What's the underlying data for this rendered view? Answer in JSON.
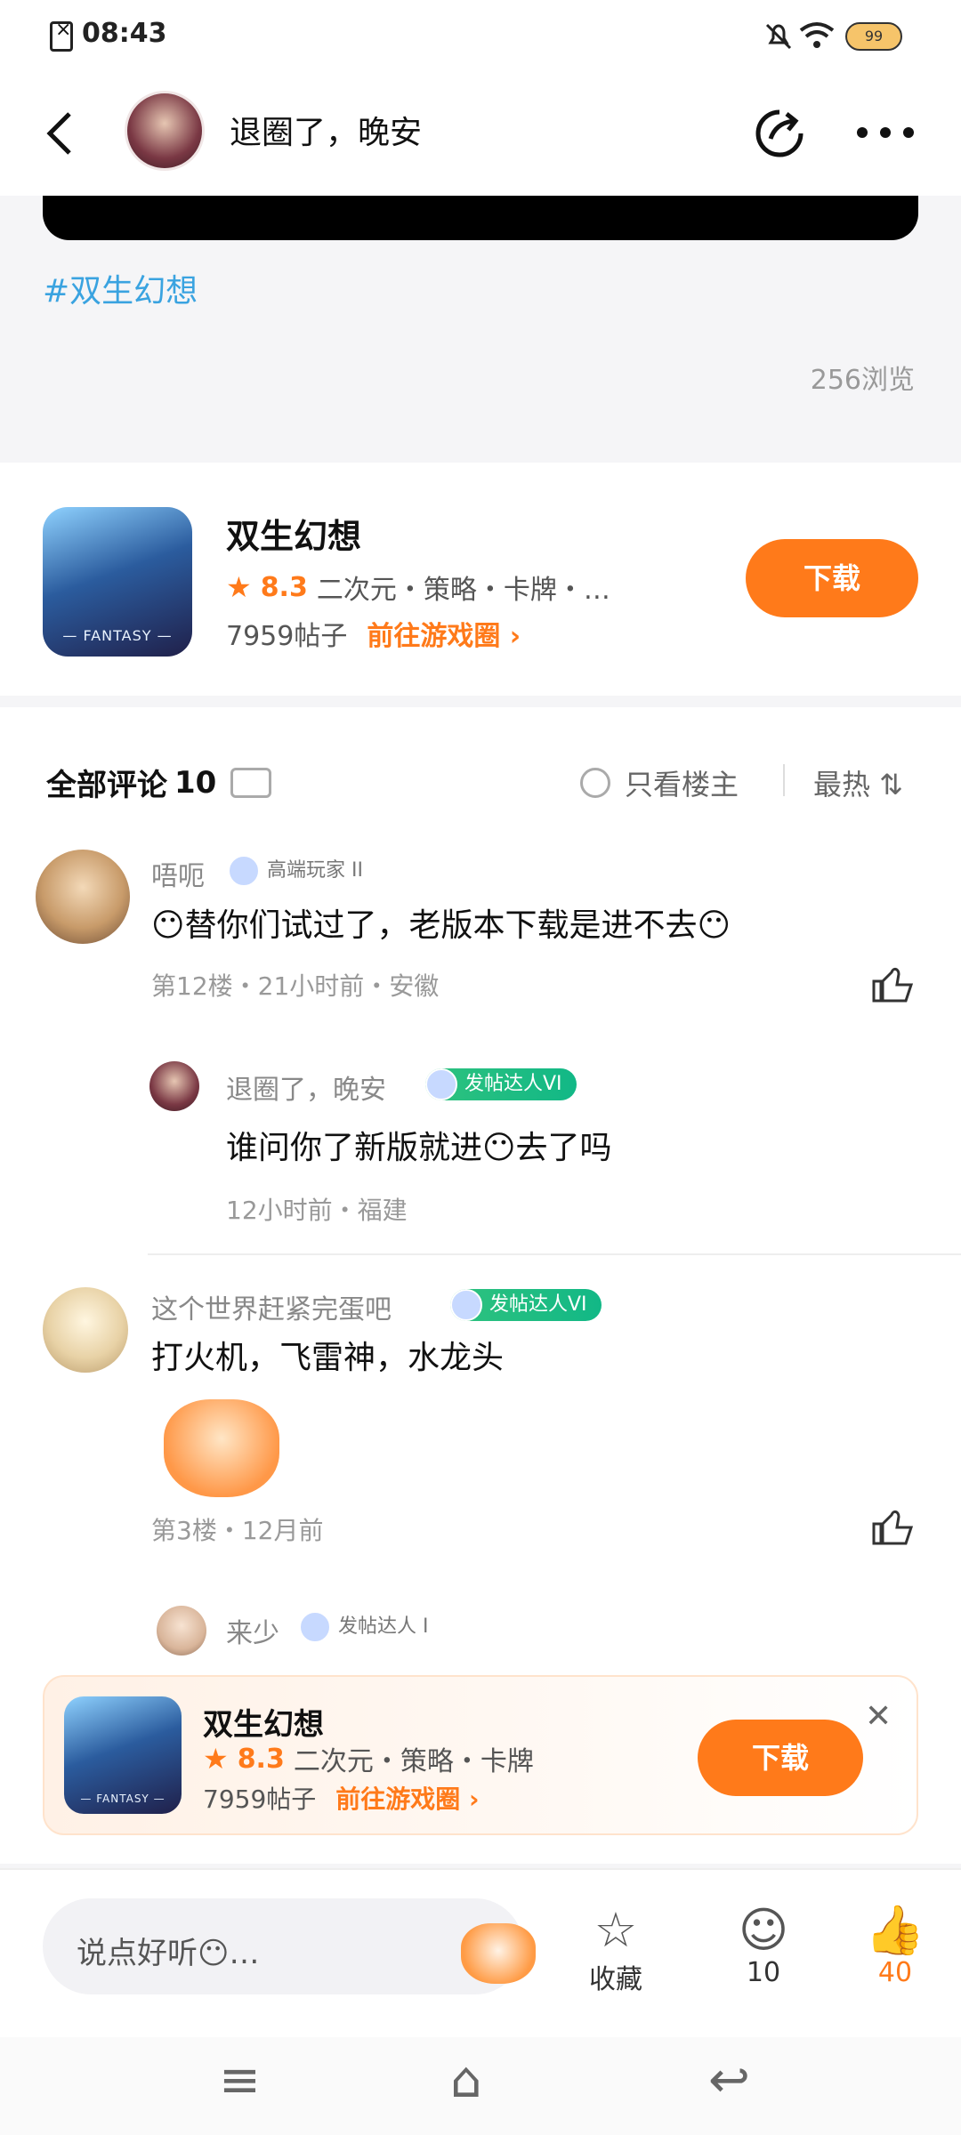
{
  "status": {
    "time": "08:43",
    "battery": "99"
  },
  "header": {
    "title": "退圈了，晚安"
  },
  "post": {
    "tag": "#双生幻想",
    "views": "256浏览"
  },
  "game": {
    "name": "双生幻想",
    "score": "8.3",
    "genres": "二次元・策略・卡牌・…",
    "posts": "7959帖子",
    "goto": "前往游戏圈 ›",
    "download": "下载"
  },
  "comments": {
    "title": "全部评论",
    "count": "10",
    "only_op": "只看楼主",
    "sort": "最热 ⇅",
    "items": [
      {
        "user": "唔呃",
        "badge": "高端玩家 II",
        "text": "😶替你们试过了，老版本下载是进不去😶",
        "meta": "第12楼・21小时前・安徽",
        "reply": {
          "user": "退圈了，晚安",
          "badge": "发帖达人VI",
          "text": "谁问你了新版就进😶去了吗",
          "meta": "12小时前・福建"
        }
      },
      {
        "user": "这个世界赶紧完蛋吧",
        "badge": "发帖达人VI",
        "text": "打火机，飞雷神，水龙头",
        "meta": "第3楼・12月前",
        "reply": {
          "user": "来少",
          "badge": "发帖达人 I"
        }
      }
    ]
  },
  "float_card": {
    "name": "双生幻想",
    "score": "8.3",
    "genres": "二次元・策略・卡牌",
    "posts": "7959帖子",
    "goto": "前往游戏圈 ›",
    "download": "下载"
  },
  "bottom": {
    "input_placeholder": "说点好听😶…",
    "favorite": "收藏",
    "comment_count": "10",
    "like_count": "40"
  }
}
